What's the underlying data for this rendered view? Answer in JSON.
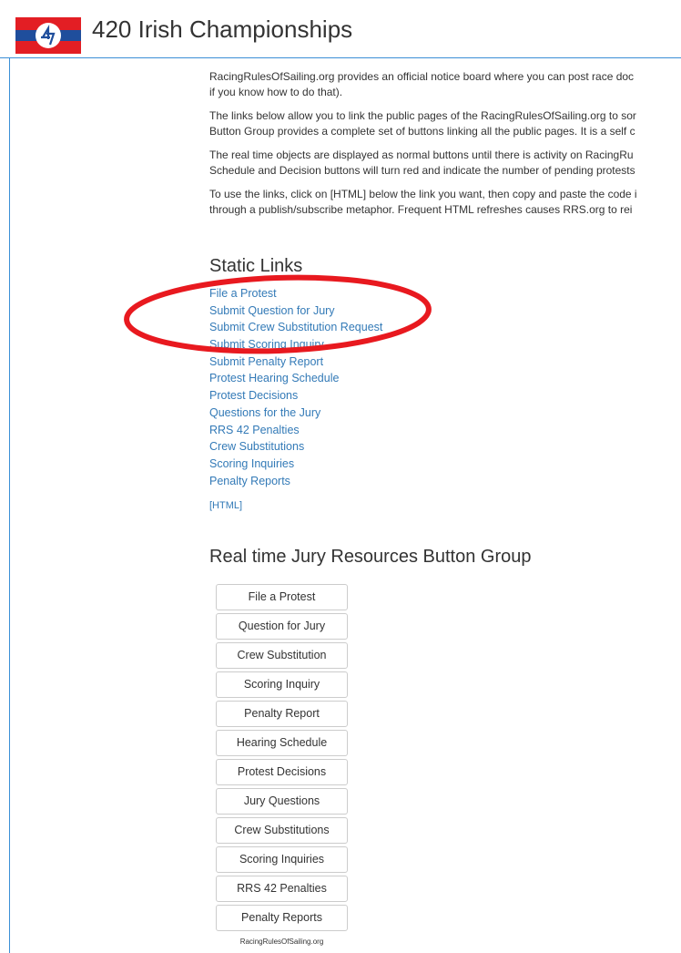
{
  "header": {
    "title": "420 Irish Championships",
    "logo_text": "4/2/0",
    "colors": {
      "flag_red": "#e31e24",
      "flag_blue": "#1f4e9c",
      "border": "#3b8fd6"
    }
  },
  "intro": {
    "paragraphs": [
      [
        "RacingRulesOfSailing.org provides an official notice board where you can post race doc",
        "if you know how to do that)."
      ],
      [
        "The links below allow you to link the public pages of the RacingRulesOfSailing.org to sor",
        "Button Group provides a complete set of buttons linking all the public pages. It is a self c"
      ],
      [
        "The real time objects are displayed as normal buttons until there is activity on RacingRu",
        "Schedule and Decision buttons will turn red and indicate the number of pending protests"
      ],
      [
        "To use the links, click on [HTML] below the link you want, then copy and paste the code i",
        "through a publish/subscribe metaphor. Frequent HTML refreshes causes RRS.org to rei"
      ]
    ]
  },
  "static_links": {
    "heading": "Static Links",
    "items": [
      "File a Protest",
      "Submit Question for Jury",
      "Submit Crew Substitution Request",
      "Submit Scoring Inquiry",
      "Submit Penalty Report",
      "Protest Hearing Schedule",
      "Protest Decisions",
      "Questions for the Jury",
      "RRS 42 Penalties",
      "Crew Substitutions",
      "Scoring Inquiries",
      "Penalty Reports"
    ],
    "html_label": "[HTML]",
    "link_color": "#337ab7",
    "annotation_color": "#e8191f"
  },
  "realtime": {
    "heading": "Real time Jury Resources Button Group",
    "buttons": [
      "File a Protest",
      "Question for Jury",
      "Crew Substitution",
      "Scoring Inquiry",
      "Penalty Report",
      "Hearing Schedule",
      "Protest Decisions",
      "Jury Questions",
      "Crew Substitutions",
      "Scoring Inquiries",
      "RRS 42 Penalties",
      "Penalty Reports"
    ],
    "footer": "RacingRulesOfSailing.org"
  }
}
